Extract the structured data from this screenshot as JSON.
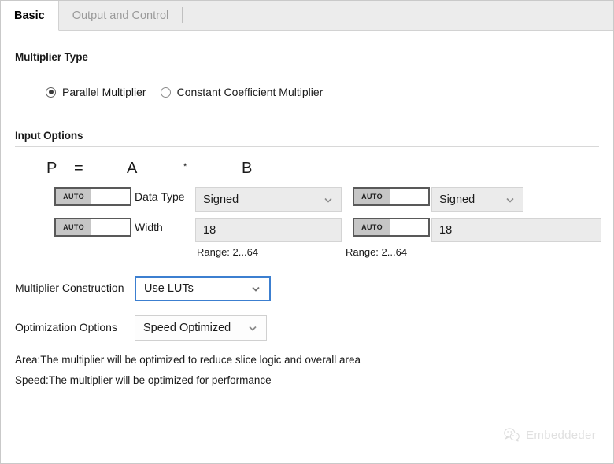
{
  "window": {
    "tabs": [
      {
        "label": "Basic",
        "active": true
      },
      {
        "label": "Output and Control",
        "active": false
      }
    ]
  },
  "multiplier_type": {
    "section_title": "Multiplier Type",
    "options": [
      {
        "label": "Parallel Multiplier",
        "selected": true
      },
      {
        "label": "Constant Coefficient Multiplier",
        "selected": false
      }
    ]
  },
  "input_options": {
    "section_title": "Input Options",
    "formula": {
      "product": "P",
      "equals": "=",
      "operand_a": "A",
      "operator": "*",
      "operand_b": "B"
    },
    "rows": [
      {
        "label": "Data Type",
        "auto_label": "AUTO",
        "a_value": "Signed",
        "b_value": "Signed",
        "control": "dropdown"
      },
      {
        "label": "Width",
        "auto_label": "AUTO",
        "a_value": "18",
        "b_value": "18",
        "control": "text"
      }
    ],
    "range_a": "Range: 2...64",
    "range_b": "Range: 2...64"
  },
  "construction": {
    "label": "Multiplier Construction",
    "value": "Use LUTs"
  },
  "optimization": {
    "label": "Optimization Options",
    "value": "Speed Optimized",
    "description_area": "Area:The multiplier will be optimized to reduce slice logic and overall area",
    "description_speed": "Speed:The multiplier will be optimized for performance"
  },
  "watermark": {
    "text": "Embeddeder",
    "icon": "wechat-icon"
  },
  "colors": {
    "focus_border": "#3c7fd0",
    "tab_strip_bg": "#ececec",
    "field_bg": "#ebebeb",
    "toggle_on_bg": "#c6c6c6"
  }
}
